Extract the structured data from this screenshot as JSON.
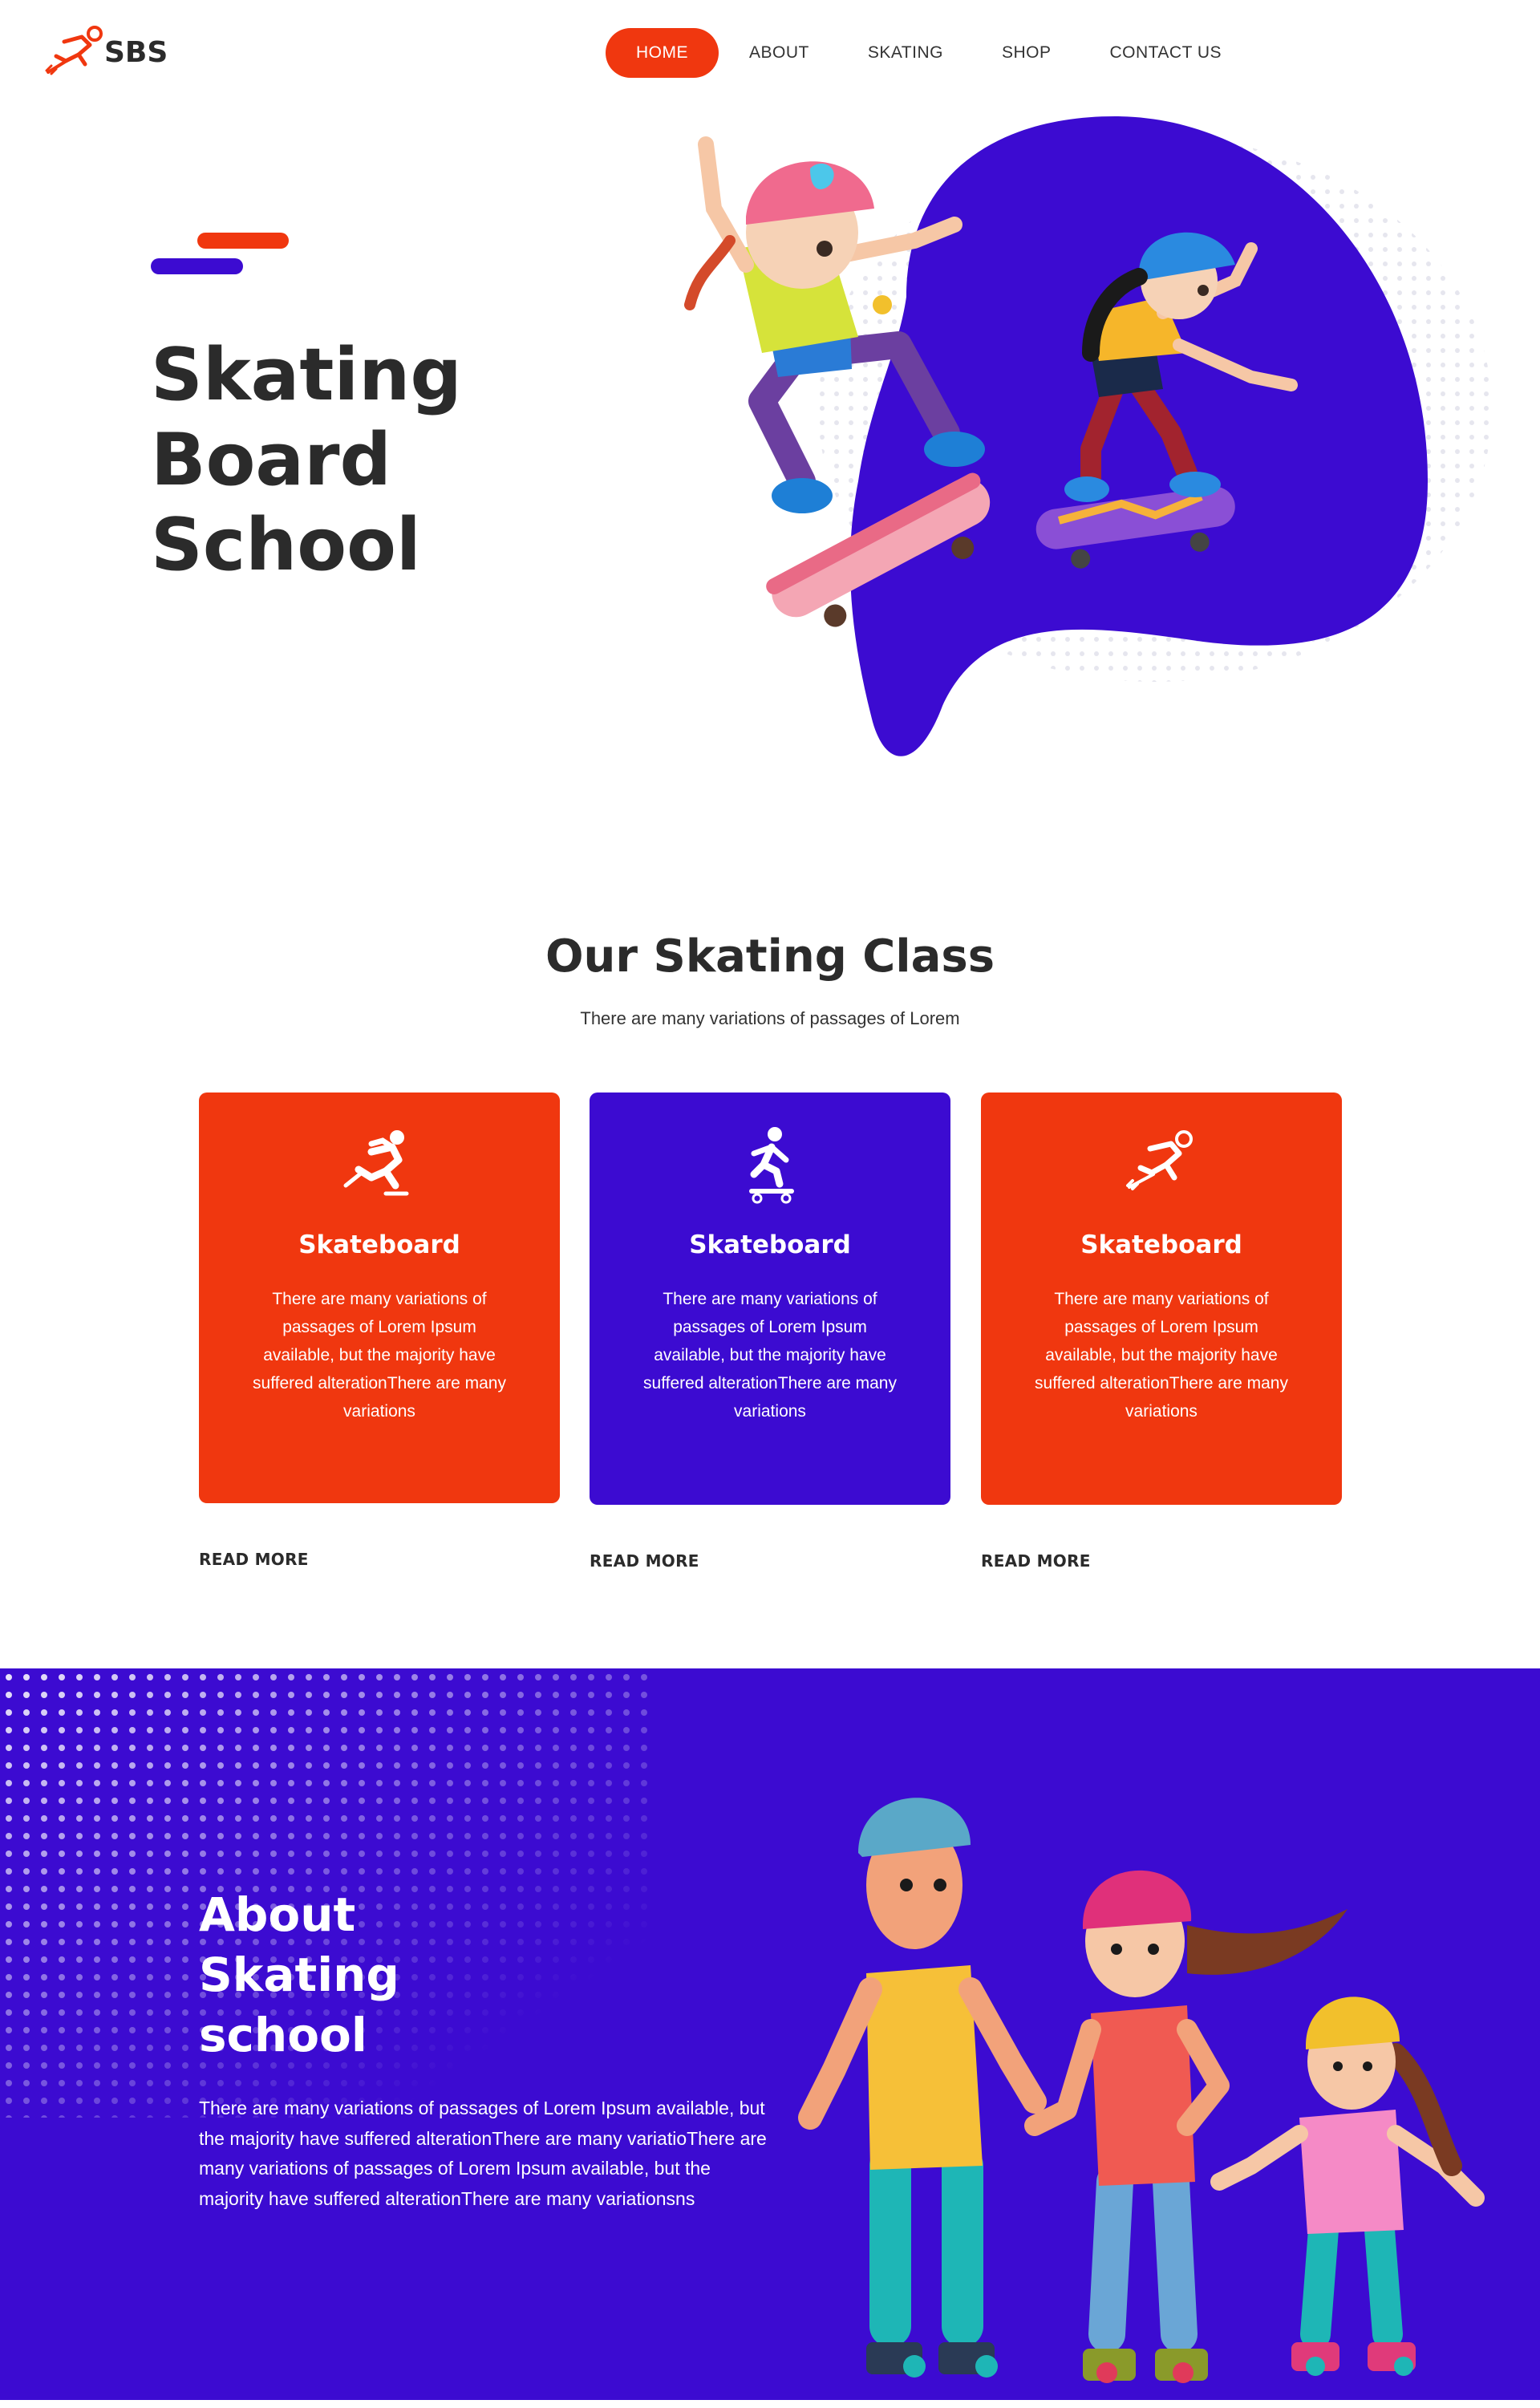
{
  "brand": {
    "name": "SBS",
    "logo_icon": "skater-logo-icon",
    "accent": "#f0370f",
    "primary": "#3c0bd1"
  },
  "nav": {
    "items": [
      {
        "label": "HOME",
        "active": true
      },
      {
        "label": "ABOUT",
        "active": false
      },
      {
        "label": "SKATING",
        "active": false
      },
      {
        "label": "SHOP",
        "active": false
      },
      {
        "label": "CONTACT US",
        "active": false
      }
    ]
  },
  "hero": {
    "title_lines": [
      "Skating",
      "Board",
      "School"
    ],
    "illustration": "kids-skateboarding-illustration"
  },
  "classes": {
    "title": "Our Skating Class",
    "subtitle": "There are many variations of passages of Lorem",
    "cards": [
      {
        "icon": "ice-skater-icon",
        "title": "Skateboard",
        "text": "There are many variations of passages of Lorem Ipsum available, but the majority have suffered alterationThere are many variations",
        "link": "READ MORE",
        "color": "#f0370f"
      },
      {
        "icon": "skateboarder-icon",
        "title": "Skateboard",
        "text": "There are many variations of passages of Lorem Ipsum available, but the majority have suffered alterationThere are many variations",
        "link": "READ MORE",
        "color": "#3c0bd1"
      },
      {
        "icon": "speed-skater-icon",
        "title": "Skateboard",
        "text": "There are many variations of passages of Lorem Ipsum available, but the majority have suffered alterationThere are many variations",
        "link": "READ MORE",
        "color": "#f0370f"
      }
    ]
  },
  "about": {
    "title_lines": [
      "About",
      "Skating",
      "school"
    ],
    "text": "There are many variations of passages of Lorem Ipsum available, but the majority have suffered alterationThere are many variatioThere are many variations of passages of Lorem Ipsum available, but the majority have suffered alterationThere are many variationsns",
    "illustration": "family-rollerskating-illustration"
  }
}
